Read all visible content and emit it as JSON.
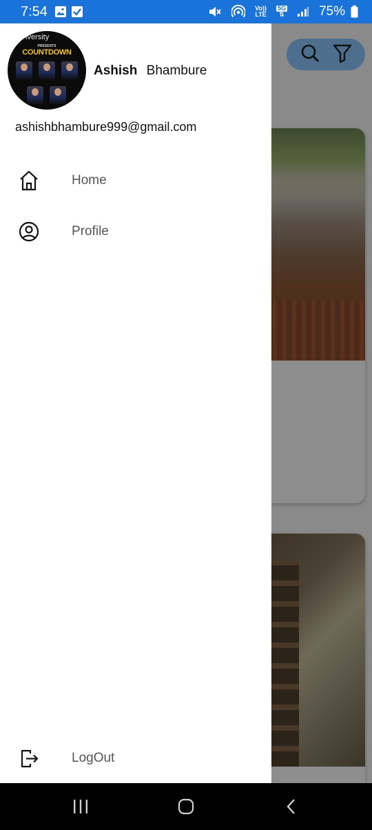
{
  "status_bar": {
    "time": "7:54",
    "battery_percent": "75%",
    "network_top": "Vo))",
    "network_bottom": "LTE",
    "data_top": "5G",
    "icons": [
      "gallery-icon",
      "checkbox-notification-icon",
      "mute-icon",
      "hotspot-icon",
      "signal-icon",
      "battery-icon"
    ]
  },
  "drawer": {
    "avatar": {
      "university_text": "iversity",
      "presents_text": "PRESENTS",
      "title_text": "COUNTDOWN"
    },
    "user": {
      "first_name": "Ashish",
      "last_name": "Bhambure",
      "email": "ashishbhambure999@gmail.com"
    },
    "menu": [
      {
        "label": "Home",
        "icon": "home-icon"
      },
      {
        "label": "Profile",
        "icon": "profile-icon"
      }
    ],
    "logout": {
      "label": "LogOut",
      "icon": "logout-icon"
    }
  },
  "background_app": {
    "toolbar_icons": [
      "search-icon",
      "filter-icon"
    ]
  },
  "nav_bar": {
    "buttons": [
      "recent-apps-icon",
      "home-nav-icon",
      "back-icon"
    ]
  },
  "colors": {
    "status_bar": "#1a73d9",
    "scrim": "#7a7a7a",
    "drawer_bg": "#ffffff",
    "nav_bar": "#000000"
  }
}
